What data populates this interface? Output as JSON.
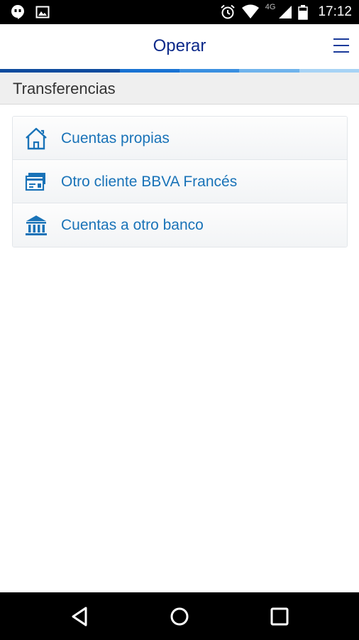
{
  "status_bar": {
    "time": "17:12",
    "network": "4G",
    "icons": [
      "hangouts-icon",
      "image-notification-icon",
      "alarm-icon",
      "wifi-icon",
      "signal-icon",
      "battery-icon"
    ]
  },
  "app_bar": {
    "title": "Operar",
    "menu_icon": "hamburger-menu-icon"
  },
  "accent_stripe_colors": [
    "#0d4b9e",
    "#0d4b9e",
    "#1973d3",
    "#3a8fe0",
    "#6fb3ec",
    "#a7d3f5"
  ],
  "section": {
    "title": "Transferencias"
  },
  "transfer_options": [
    {
      "label": "Cuentas propias",
      "icon": "house-icon"
    },
    {
      "label": "Otro cliente BBVA Francés",
      "icon": "bank-card-icon"
    },
    {
      "label": "Cuentas a otro banco",
      "icon": "bank-building-icon"
    }
  ],
  "nav_bar": {
    "buttons": [
      "back-icon",
      "home-icon",
      "recents-icon"
    ]
  },
  "colors": {
    "title_blue": "#0d2a8a",
    "link_blue": "#1973b8",
    "icon_blue": "#1973b8"
  }
}
